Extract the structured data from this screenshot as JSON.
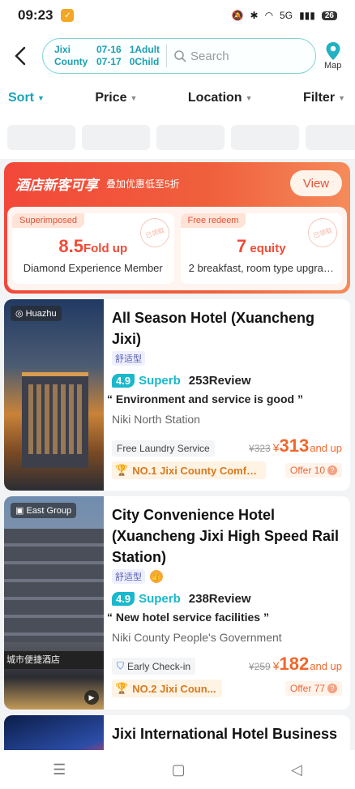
{
  "status": {
    "time": "09:23",
    "network": "5G",
    "battery": "26"
  },
  "header": {
    "city_line1": "Jixi",
    "city_line2": "County",
    "checkin": "07-16",
    "checkout": "07-17",
    "adults": "1Adult",
    "children": "0Child",
    "search_placeholder": "Search",
    "map_label": "Map"
  },
  "sortbar": {
    "sort": "Sort",
    "price": "Price",
    "location": "Location",
    "filter": "Filter"
  },
  "promo": {
    "title": "酒店新客可享",
    "subtitle": "叠加优惠低至5折",
    "view_label": "View",
    "cards": [
      {
        "tag": "Superimposed",
        "value_number": "8.5",
        "value_text": "Fold up",
        "desc": "Diamond Experience Member",
        "stamp": "已领取"
      },
      {
        "tag": "Free redeem",
        "value_number": "7",
        "value_text": " equity",
        "desc": "2 breakfast, room type upgra…",
        "stamp": "已领取"
      }
    ]
  },
  "hotels": [
    {
      "brand": "Huazhu",
      "name": "All Season Hotel (Xuancheng Jixi)",
      "type": "舒适型",
      "score": "4.9",
      "level": "Superb",
      "reviews": "253Review",
      "quote": "“ Environment and service is good ”",
      "location": "Niki North Station",
      "service": "Free Laundry Service",
      "old_price": "¥323",
      "currency": "¥",
      "price": "313",
      "price_suffix": "and up",
      "rank": "NO.1 Jixi County Comfo...",
      "offer": "Offer 10"
    },
    {
      "brand": "East Group",
      "name": "City Convenience Hotel (Xuancheng Jixi High Speed Rail Station)",
      "type": "舒适型",
      "score": "4.9",
      "level": "Superb",
      "reviews": "238Review",
      "quote": "“ New hotel service facilities ”",
      "location": "Niki County People's Government",
      "service": "Early Check-in",
      "old_price": "¥259",
      "currency": "¥",
      "price": "182",
      "price_suffix": "and up",
      "rank": "NO.2 Jixi Coun...",
      "offer": "Offer 77",
      "sign_text": "城市便捷酒店"
    },
    {
      "name": "Jixi International Hotel Business"
    }
  ],
  "colors": {
    "accent": "#1aa3b8",
    "price": "#f0672a",
    "promo": "#f2483a"
  }
}
